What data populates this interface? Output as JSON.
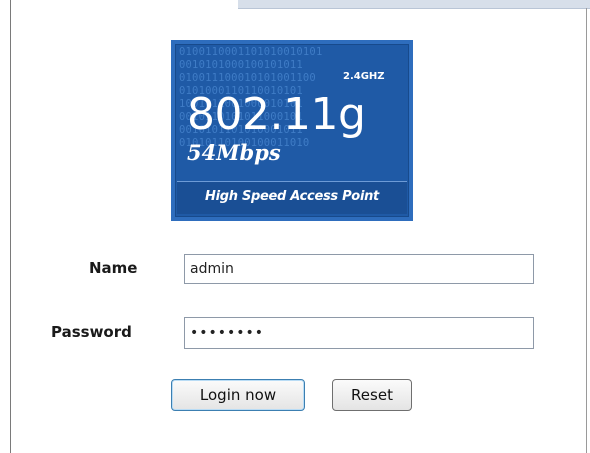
{
  "logo": {
    "band_label": "2.4GHZ",
    "standard": "802.11g",
    "speed": "54Mbps",
    "caption": "High Speed Access Point",
    "binary_pattern": "0100110001101010010101\n0010101000100101011\n010011100010101001100\n0101000110110010101\n1001011001000010101\n0010110101011000101\n0010101101010001011\n01010110100100011010",
    "colors": {
      "background": "#1f5aa6",
      "text": "#ffffff"
    }
  },
  "form": {
    "name_label": "Name",
    "name_value": "admin",
    "password_label": "Password",
    "password_value": "password",
    "login_label": "Login now",
    "reset_label": "Reset"
  }
}
